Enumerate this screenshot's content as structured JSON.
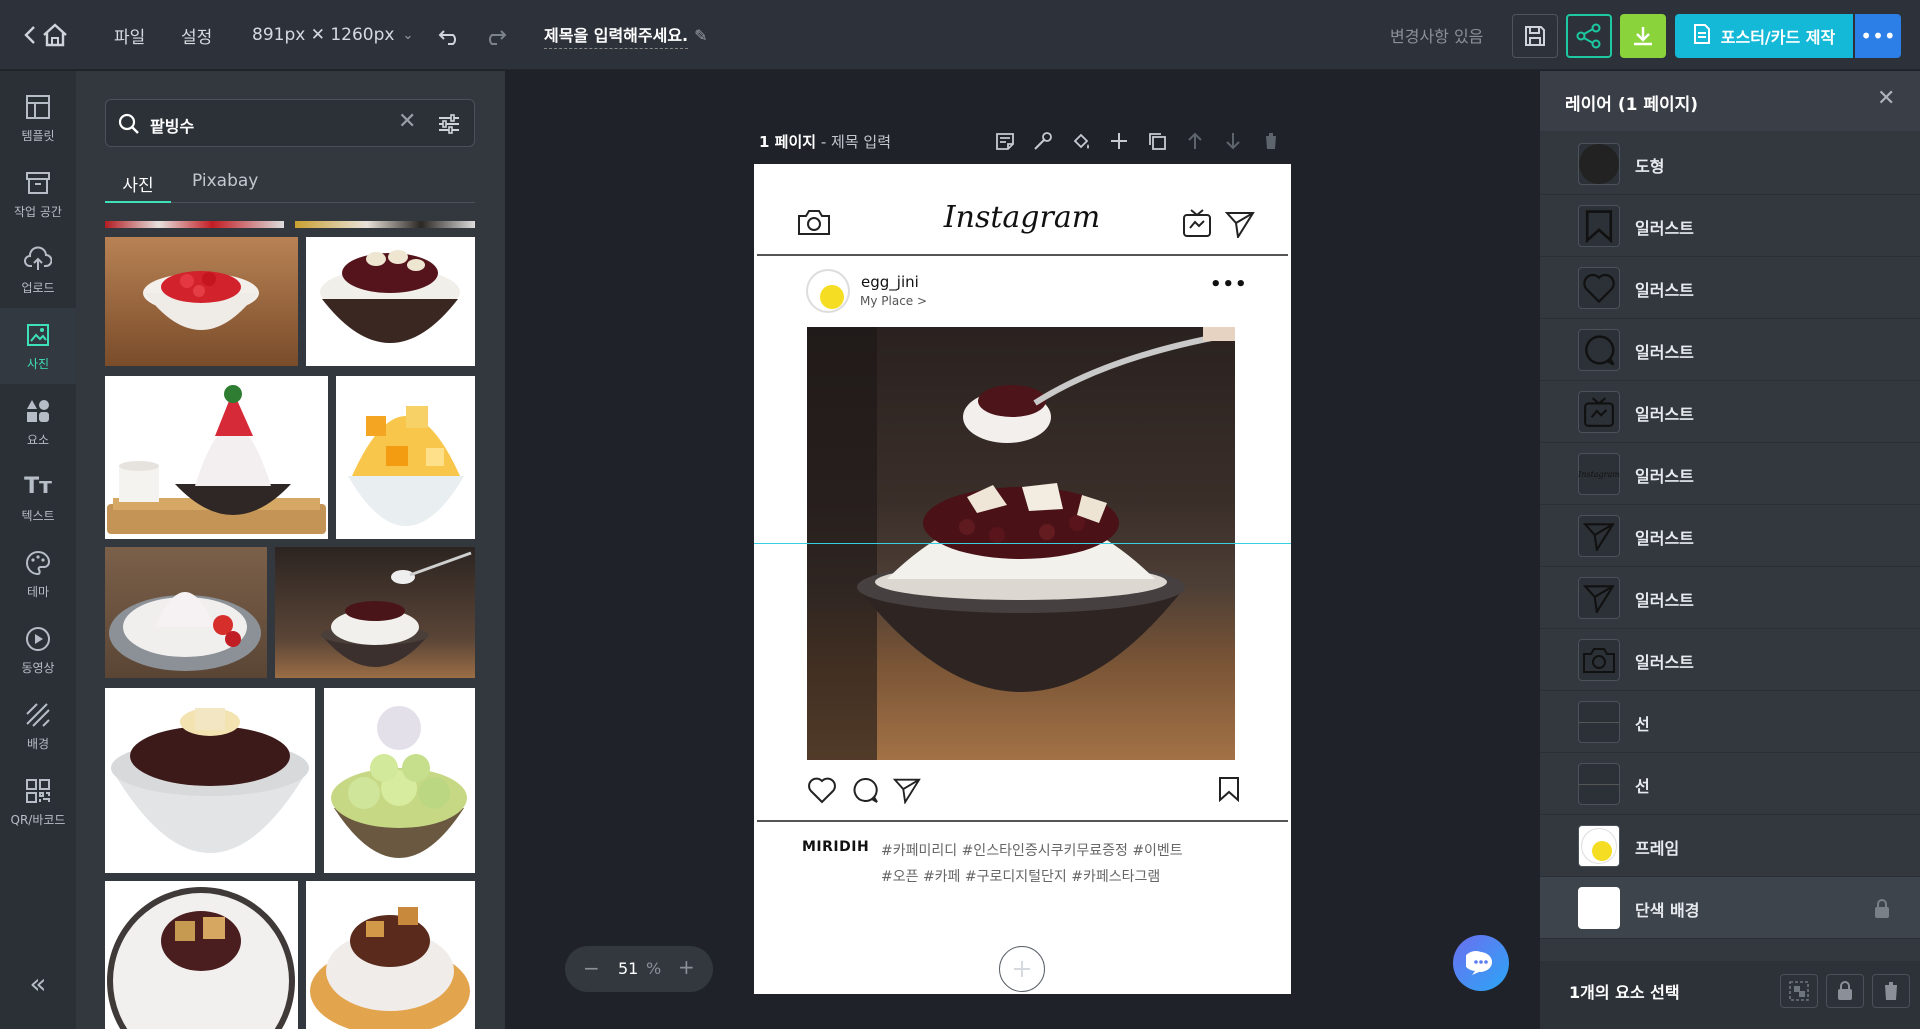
{
  "topbar": {
    "file_menu": "파일",
    "settings_menu": "설정",
    "size_label": "891px ✕ 1260px",
    "doc_title": "제목을 입력해주세요.",
    "change_status": "변경사항 있음",
    "make_button": "포스터/카드 제작"
  },
  "sidebar": {
    "items": [
      {
        "label": "템플릿",
        "icon": "template-icon"
      },
      {
        "label": "작업 공간",
        "icon": "workspace-icon"
      },
      {
        "label": "업로드",
        "icon": "upload-icon"
      },
      {
        "label": "사진",
        "icon": "photo-icon"
      },
      {
        "label": "요소",
        "icon": "elements-icon"
      },
      {
        "label": "텍스트",
        "icon": "text-icon"
      },
      {
        "label": "테마",
        "icon": "palette-icon"
      },
      {
        "label": "동영상",
        "icon": "video-icon"
      },
      {
        "label": "배경",
        "icon": "background-icon"
      },
      {
        "label": "QR/바코드",
        "icon": "qr-icon"
      }
    ],
    "collapse": "«"
  },
  "panel": {
    "search_value": "팥빙수",
    "tabs": [
      "사진",
      "Pixabay"
    ]
  },
  "canvas": {
    "page_label": "1 페이지",
    "page_title": "- 제목 입력",
    "zoom_value": "51",
    "zoom_unit": "%",
    "post": {
      "logo": "Instagram",
      "username": "egg_jini",
      "place": "My Place >",
      "brand": "MIRIDIH",
      "hashtags_line1": "#카페미리디 #인스타인증시쿠키무료증정 #이벤트",
      "hashtags_line2": "#오픈 #카페 #구로디지털단지 #카페스타그램"
    }
  },
  "layers": {
    "title": "레이어 (1 페이지)",
    "items": [
      {
        "label": "도형",
        "icon": "circle-shape-icon"
      },
      {
        "label": "일러스트",
        "icon": "bookmark-icon"
      },
      {
        "label": "일러스트",
        "icon": "heart-icon"
      },
      {
        "label": "일러스트",
        "icon": "comment-icon"
      },
      {
        "label": "일러스트",
        "icon": "igtv-icon"
      },
      {
        "label": "일러스트",
        "icon": "instagram-logo-icon"
      },
      {
        "label": "일러스트",
        "icon": "send-icon"
      },
      {
        "label": "일러스트",
        "icon": "send-icon"
      },
      {
        "label": "일러스트",
        "icon": "camera-icon"
      },
      {
        "label": "선",
        "icon": "line-icon"
      },
      {
        "label": "선",
        "icon": "line-icon"
      },
      {
        "label": "프레임",
        "icon": "frame-icon"
      },
      {
        "label": "단색 배경",
        "icon": "solid-bg-icon"
      }
    ],
    "selection_status": "1개의 요소 선택"
  },
  "colors": {
    "accent": "#3ee0b9",
    "share": "#1cc9a0",
    "download": "#8bd33a",
    "make": "#13b9d6",
    "more": "#2d7fe8"
  }
}
